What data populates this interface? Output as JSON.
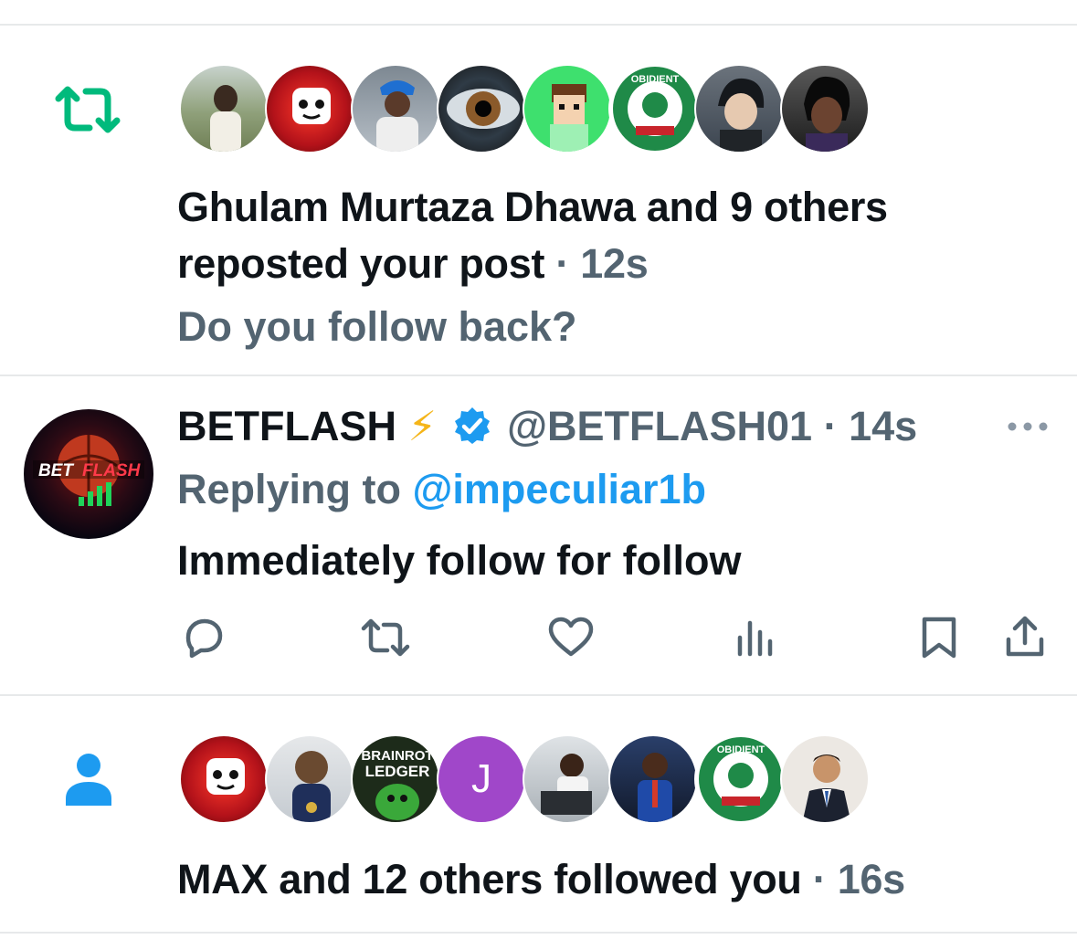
{
  "repost_notification": {
    "icon": "repost-icon",
    "icon_color": "#00ba7c",
    "avatars": [
      {
        "name": "avatar-1",
        "bg": "#8fa07a"
      },
      {
        "name": "avatar-2",
        "bg": "#b3121a"
      },
      {
        "name": "avatar-3",
        "bg": "#9aa7b4"
      },
      {
        "name": "avatar-4",
        "bg": "#2f3b46"
      },
      {
        "name": "avatar-5",
        "bg": "#3ee06e"
      },
      {
        "name": "avatar-6",
        "bg": "#1f8a48"
      },
      {
        "name": "avatar-7",
        "bg": "#3c4550"
      },
      {
        "name": "avatar-8",
        "bg": "#2a2a2a"
      }
    ],
    "headline": "Ghulam Murtaza Dhawa and 9 others reposted your post",
    "separator": " · ",
    "time": "12s",
    "subtext": "Do you follow back?"
  },
  "reply_tweet": {
    "display_name": "BETFLASH",
    "name_emoji": "⚡",
    "verified_color": "#1d9bf0",
    "handle": "@BETFLASH01",
    "separator": " · ",
    "time": "14s",
    "replying_label": "Replying to",
    "replying_handle": "@impeculiar1b",
    "text": "Immediately follow for follow",
    "actions": [
      "reply-icon",
      "repost-icon",
      "like-icon",
      "views-icon",
      "bookmark-icon",
      "share-icon"
    ]
  },
  "follow_notification": {
    "icon": "person-icon",
    "icon_color": "#1d9bf0",
    "avatars": [
      {
        "name": "avatar-1",
        "bg": "#b3121a"
      },
      {
        "name": "avatar-2",
        "bg": "#cfd4da"
      },
      {
        "name": "avatar-3",
        "bg": "#1d2b1a"
      },
      {
        "name": "avatar-4",
        "bg": "#a047c9",
        "letter": "J"
      },
      {
        "name": "avatar-5",
        "bg": "#c8ccd0"
      },
      {
        "name": "avatar-6",
        "bg": "#1c2a44"
      },
      {
        "name": "avatar-7",
        "bg": "#1f8a48"
      },
      {
        "name": "avatar-8",
        "bg": "#e8e3de"
      }
    ],
    "headline": "MAX and 12 others followed you",
    "separator": " · ",
    "time": "16s"
  }
}
